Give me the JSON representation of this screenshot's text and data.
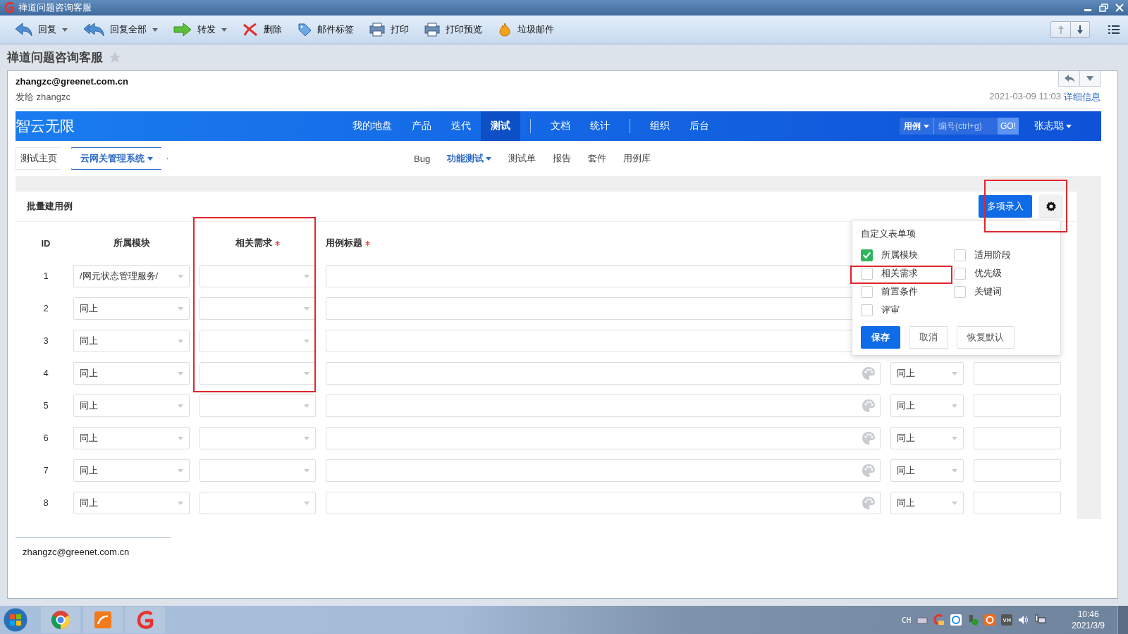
{
  "window": {
    "title": "禅道问题咨询客服"
  },
  "toolbar": [
    {
      "label": "回复",
      "dropdown": true
    },
    {
      "label": "回复全部",
      "dropdown": true
    },
    {
      "label": "转发",
      "dropdown": true
    },
    {
      "label": "删除",
      "dropdown": false
    },
    {
      "label": "邮件标签",
      "dropdown": false
    },
    {
      "label": "打印",
      "dropdown": false
    },
    {
      "label": "打印预览",
      "dropdown": false
    },
    {
      "label": "垃圾邮件",
      "dropdown": false
    }
  ],
  "subject": "禅道问题咨询客服",
  "mail": {
    "from": "zhangzc@greenet.com.cn",
    "to": "发给 zhangzc",
    "date": "2021-03-09 11:03",
    "details_link": "详细信息",
    "signature": "zhangzc@greenet.com.cn"
  },
  "app": {
    "logo": "智云无限",
    "nav": [
      {
        "label": "我的地盘",
        "kind": "item",
        "selected": false
      },
      {
        "label": "产品",
        "kind": "item",
        "selected": false
      },
      {
        "label": "迭代",
        "kind": "item",
        "selected": false
      },
      {
        "label": "测试",
        "kind": "item",
        "selected": true
      },
      {
        "kind": "separator"
      },
      {
        "label": "文档",
        "kind": "item",
        "selected": false
      },
      {
        "label": "统计",
        "kind": "item",
        "selected": false
      },
      {
        "kind": "separator"
      },
      {
        "label": "组织",
        "kind": "item",
        "selected": false
      },
      {
        "label": "后台",
        "kind": "item",
        "selected": false
      }
    ],
    "search": {
      "type_label": "用例",
      "placeholder": "编号(ctrl+g)",
      "go": "GO!"
    },
    "user": "张志聪",
    "breadcrumb": [
      {
        "label": "测试主页",
        "dropdown": false
      },
      {
        "label": "云网关管理系统",
        "dropdown": true
      }
    ],
    "subnav": [
      {
        "label": "Bug",
        "selected": false,
        "dropdown": false
      },
      {
        "label": "功能测试",
        "selected": true,
        "dropdown": true
      },
      {
        "label": "测试单",
        "selected": false,
        "dropdown": false
      },
      {
        "label": "报告",
        "selected": false,
        "dropdown": false
      },
      {
        "label": "套件",
        "selected": false,
        "dropdown": false
      },
      {
        "label": "用例库",
        "selected": false,
        "dropdown": false
      }
    ]
  },
  "form": {
    "title": "批量建用例",
    "batch_button": "多项录入",
    "columns": [
      {
        "label": "ID",
        "required": false
      },
      {
        "label": "所属模块",
        "required": false
      },
      {
        "label": "相关需求",
        "required": true
      },
      {
        "label": "用例标题",
        "required": true
      }
    ],
    "rows": [
      {
        "id": "1",
        "module": "/网元状态管理服务/"
      },
      {
        "id": "2",
        "module": "同上"
      },
      {
        "id": "3",
        "module": "同上"
      },
      {
        "id": "4",
        "module": "同上",
        "stage": "同上"
      },
      {
        "id": "5",
        "module": "同上",
        "stage": "同上"
      },
      {
        "id": "6",
        "module": "同上",
        "stage": "同上"
      },
      {
        "id": "7",
        "module": "同上",
        "stage": "同上"
      },
      {
        "id": "8",
        "module": "同上",
        "stage": "同上"
      }
    ]
  },
  "popup": {
    "title": "自定义表单项",
    "options": [
      {
        "label": "所属模块",
        "checked": true
      },
      {
        "label": "适用阶段",
        "checked": false
      },
      {
        "label": "相关需求",
        "checked": false
      },
      {
        "label": "优先级",
        "checked": false
      },
      {
        "label": "前置条件",
        "checked": false
      },
      {
        "label": "关键词",
        "checked": false
      },
      {
        "label": "评审",
        "checked": false
      }
    ],
    "buttons": [
      {
        "label": "保存",
        "kind": "primary"
      },
      {
        "label": "取消",
        "kind": "default"
      },
      {
        "label": "恢复默认",
        "kind": "default"
      }
    ]
  },
  "taskbar": {
    "lang": "CH",
    "time": "10:46",
    "date": "2021/3/9"
  }
}
